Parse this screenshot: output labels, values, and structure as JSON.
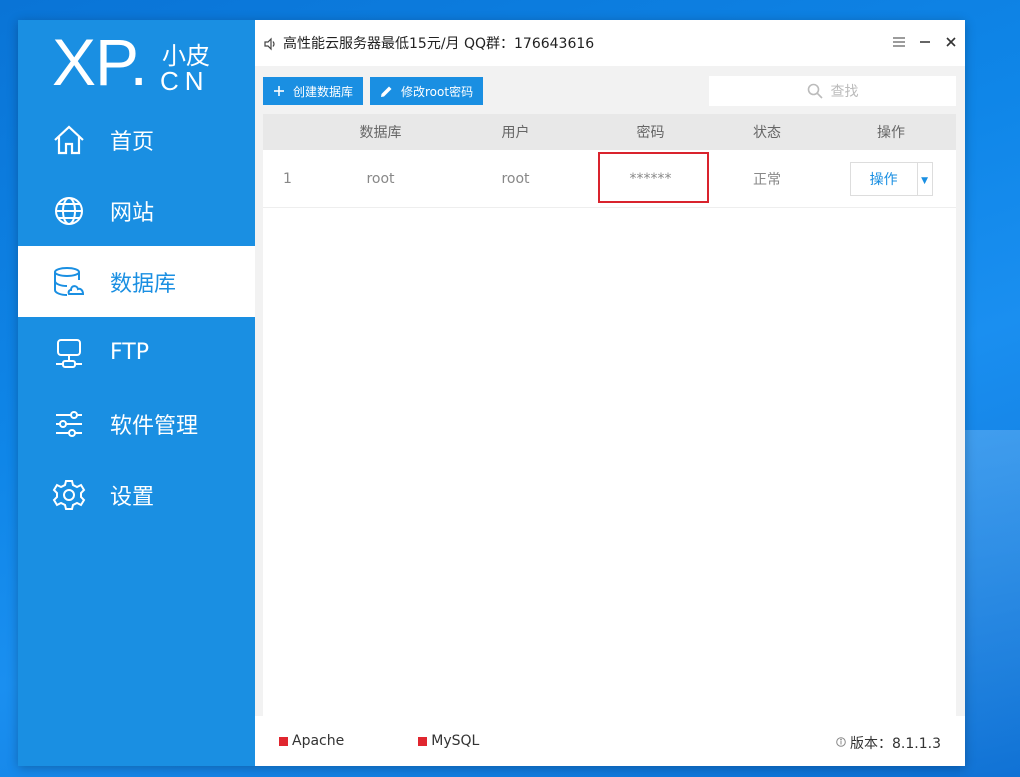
{
  "colors": {
    "accent": "#1a8fe2",
    "service_stopped": "#e0262f",
    "highlight_border": "#d9232d"
  },
  "logo": {
    "main": "XP.",
    "top": "小皮",
    "bottom": "CN"
  },
  "sidebar": {
    "items": [
      {
        "label": "首页",
        "icon": "home-icon",
        "active": false
      },
      {
        "label": "网站",
        "icon": "globe-icon",
        "active": false
      },
      {
        "label": "数据库",
        "icon": "database-icon",
        "active": true
      },
      {
        "label": "FTP",
        "icon": "ftp-server-icon",
        "active": false
      },
      {
        "label": "软件管理",
        "icon": "sliders-icon",
        "active": false
      },
      {
        "label": "设置",
        "icon": "gear-icon",
        "active": false
      }
    ]
  },
  "titlebar": {
    "notice": "高性能云服务器最低15元/月  QQ群：176643616",
    "menu_icon": "hamburger-icon",
    "minimize_icon": "minimize-icon",
    "close_icon": "close-icon"
  },
  "toolbar": {
    "create_label": "创建数据库",
    "change_pw_label": "修改root密码"
  },
  "search": {
    "placeholder": "查找"
  },
  "table": {
    "headers": [
      "",
      "数据库",
      "用户",
      "密码",
      "状态",
      "操作"
    ],
    "rows": [
      {
        "index": "1",
        "database": "root",
        "user": "root",
        "password": "******",
        "status": "正常",
        "action": "操作"
      }
    ]
  },
  "footer": {
    "apache": "Apache",
    "mysql": "MySQL",
    "version": "版本：8.1.1.3"
  }
}
